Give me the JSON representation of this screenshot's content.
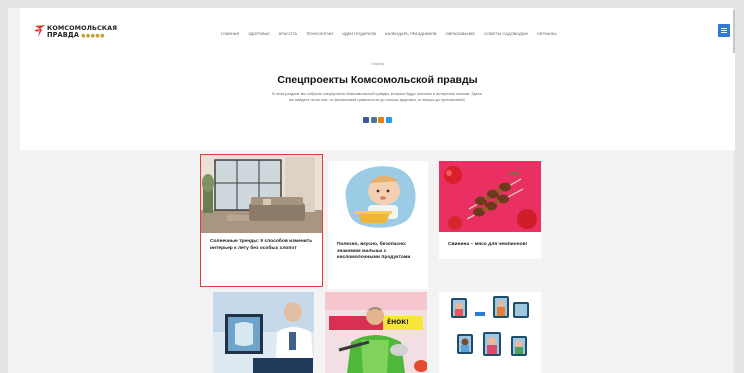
{
  "header": {
    "logo_line1": "КОМСОМОЛЬСКАЯ",
    "logo_line2": "ПРАВДА",
    "logo_dots": "●●●●●",
    "nav": [
      "Главная",
      "Здоровье",
      "Красота",
      "Технологии",
      "Идеи подарков",
      "Календарь праздников",
      "Образование",
      "Советы садоводам",
      "Сериалы"
    ]
  },
  "hero": {
    "breadcrumb": "Главная",
    "title": "Спецпроекты Комсомольской правды",
    "description": "В этом разделе мы собрали спецпроекты Комсомольской правды, которые будут полезны и интересны многим. Здесь вы найдете почти все: от финансовой грамотности до пользы здоровья, от юмора до путешествий!",
    "share_colors": [
      "#3b5998",
      "#4c75a3",
      "#ee8208",
      "#1da1f2"
    ]
  },
  "cards": [
    {
      "title": "Солнечные тренды: 9 способов изменить интерьер к лету без особых хлопот"
    },
    {
      "title": "Полезно, вкусно, безопасно: знакомим малыша с кисломолочными продуктами"
    },
    {
      "title": "Свинина – мясо для чемпионов!"
    }
  ],
  "bottom_cards": [
    {
      "banner": "ЁНОК!"
    },
    {},
    {}
  ],
  "colors": {
    "accent": "#2f7bd4",
    "highlight": "#e23b3b"
  }
}
